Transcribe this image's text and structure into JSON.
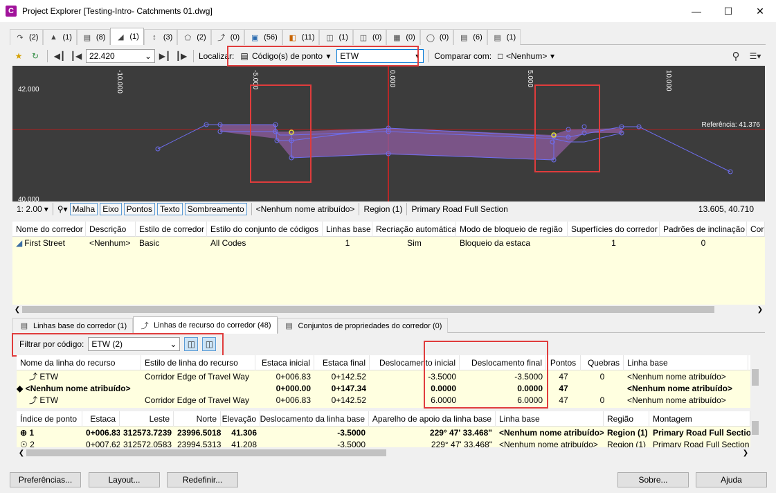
{
  "window": {
    "title": "Project Explorer [Testing-Intro- Catchments 01.dwg]",
    "app_letter": "C"
  },
  "tabs": [
    {
      "icon": "alignment-icon",
      "count": "(2)"
    },
    {
      "icon": "profile-icon",
      "count": "(1)"
    },
    {
      "icon": "profile-view-icon",
      "count": "(8)"
    },
    {
      "icon": "corridor-icon",
      "count": "(1)"
    },
    {
      "icon": "sample-line-icon",
      "count": "(3)"
    },
    {
      "icon": "surface-icon",
      "count": "(2)"
    },
    {
      "icon": "feature-line-icon",
      "count": "(0)"
    },
    {
      "icon": "point-icon",
      "count": "(56)"
    },
    {
      "icon": "parcel-icon",
      "count": "(11)"
    },
    {
      "icon": "pipe-network-icon",
      "count": "(1)"
    },
    {
      "icon": "pressure-network-icon",
      "count": "(0)"
    },
    {
      "icon": "intersection-icon",
      "count": "(0)"
    },
    {
      "icon": "catchment-icon",
      "count": "(0)"
    },
    {
      "icon": "table-icon",
      "count": "(6)"
    },
    {
      "icon": "report-icon",
      "count": "(1)"
    }
  ],
  "toolbar": {
    "station_value": "22.420",
    "locate_label": "Localizar:",
    "locate_mode": "Código(s) de ponto",
    "code_value": "ETW",
    "compare_label": "Comparar com:",
    "compare_value": "<Nenhum>"
  },
  "viewport": {
    "elev_top": "42.000",
    "elev_bottom": "40.000",
    "x_ticks": [
      "-10.000",
      "-5.000",
      "0.000",
      "5.000",
      "10.000"
    ],
    "reference_label": "Referência: 41.376"
  },
  "statusbar": {
    "scale": "1: 2.00",
    "toggles": [
      "Malha",
      "Eixo",
      "Pontos",
      "Texto",
      "Sombreamento"
    ],
    "name": "<Nenhum nome atribuído>",
    "region": "Region (1)",
    "assembly": "Primary Road Full Section",
    "coords": "13.605, 40.710"
  },
  "corridor_grid": {
    "headers": [
      "Nome do corredor",
      "Descrição",
      "Estilo de corredor",
      "Estilo do conjunto de códigos",
      "Linhas base",
      "Recriação automática",
      "Modo de bloqueio de região",
      "Superfícies do corredor",
      "Padrões de inclinação",
      "Cor"
    ],
    "row": [
      "First Street",
      "<Nenhum>",
      "Basic",
      "All Codes",
      "1",
      "Sim",
      "Bloqueio da estaca",
      "1",
      "0"
    ]
  },
  "lower_tabs": [
    "Linhas base do corredor (1)",
    "Linhas de recurso do corredor (48)",
    "Conjuntos de propriedades do corredor (0)"
  ],
  "filter": {
    "label": "Filtrar por código:",
    "value": "ETW  (2)"
  },
  "feature_grid": {
    "headers": [
      "Nome da linha do recurso",
      "Estilo de linha do recurso",
      "Estaca inicial",
      "Estaca final",
      "Deslocamento inicial",
      "Deslocamento final",
      "Pontos",
      "Quebras",
      "Linha base"
    ],
    "rows": [
      [
        "ETW",
        "Corridor Edge of Travel Way",
        "0+006.83",
        "0+142.52",
        "-3.5000",
        "-3.5000",
        "47",
        "0",
        "<Nenhum nome atribuído>"
      ],
      [
        "<Nenhum nome atribuído>",
        "",
        "0+000.00",
        "0+147.34",
        "0.0000",
        "0.0000",
        "47",
        "",
        "<Nenhum nome atribuído>"
      ],
      [
        "ETW",
        "Corridor Edge of Travel Way",
        "0+006.83",
        "0+142.52",
        "6.0000",
        "6.0000",
        "47",
        "0",
        "<Nenhum nome atribuído>"
      ]
    ]
  },
  "point_grid": {
    "headers": [
      "Índice de ponto",
      "Estaca",
      "Leste",
      "Norte",
      "Elevação",
      "Deslocamento da linha base",
      "Aparelho de apoio  da linha base",
      "Linha base",
      "Região",
      "Montagem"
    ],
    "rows": [
      [
        "1",
        "0+006.83",
        "312573.7239",
        "23996.5018",
        "41.306",
        "-3.5000",
        "229° 47' 33.468\"",
        "<Nenhum nome atribuído>",
        "Region (1)",
        "Primary Road Full Section"
      ],
      [
        "2",
        "0+007.62",
        "312572.0583",
        "23994.5313",
        "41.208",
        "-3.5000",
        "229° 47' 33.468\"",
        "<Nenhum nome atribuído>",
        "Region (1)",
        "Primary Road Full Section"
      ]
    ]
  },
  "buttons": {
    "prefs": "Preferências...",
    "layout": "Layout...",
    "reset": "Redefinir...",
    "about": "Sobre...",
    "help": "Ajuda"
  },
  "colors": {
    "accent": "#e03c3c",
    "viewport_bg": "#3c3c3c",
    "grid_row_bg": "#ffffe0",
    "profile_line": "#6e6ef0",
    "fill": "#8a5a9a"
  }
}
